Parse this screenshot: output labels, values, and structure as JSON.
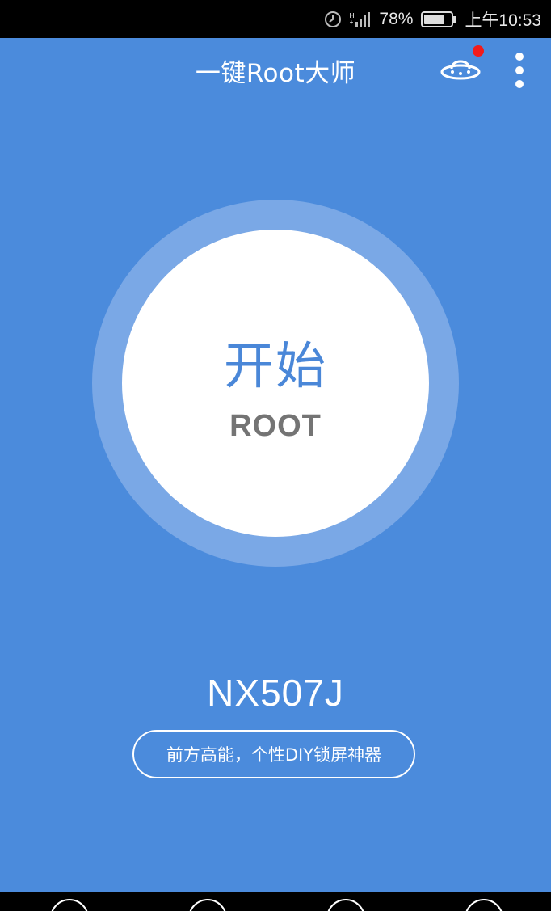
{
  "status_bar": {
    "network": "H+",
    "battery_percent": "78%",
    "time": "上午10:53",
    "battery_level": 0.78
  },
  "app": {
    "title": "一键Root大师",
    "notification_dot_color": "#f21b1b"
  },
  "root_button": {
    "main_label": "开始",
    "sub_label": "ROOT"
  },
  "device": {
    "model": "NX507J"
  },
  "promo": {
    "label": "前方高能，个性DIY锁屏神器"
  },
  "colors": {
    "background": "#4b8bdc",
    "ring": "#7aa8e6",
    "accent_text": "#4a87d8"
  },
  "icons": [
    "alarm-clock-icon",
    "signal-icon",
    "battery-icon",
    "ufo-icon",
    "more-vertical-icon"
  ]
}
